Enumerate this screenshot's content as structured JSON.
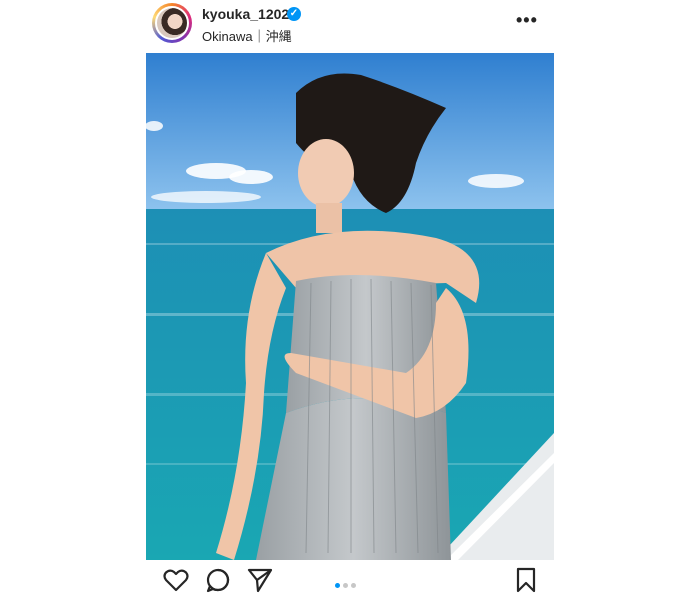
{
  "post": {
    "username": "kyouka_1202",
    "verified": true,
    "location": "Okinawa｜沖縄",
    "more_icon": "more-horizontal-icon",
    "carousel": {
      "total": 3,
      "active_index": 0
    }
  },
  "actions": {
    "icons": [
      "heart-icon",
      "comment-icon",
      "share-icon",
      "bookmark-icon"
    ]
  },
  "colors": {
    "verified_blue": "#0095f6",
    "carousel_active": "#0095f6",
    "carousel_inactive": "#c7c7c7",
    "sky": "#3f8fd6",
    "sea": "#1c9bb0"
  }
}
